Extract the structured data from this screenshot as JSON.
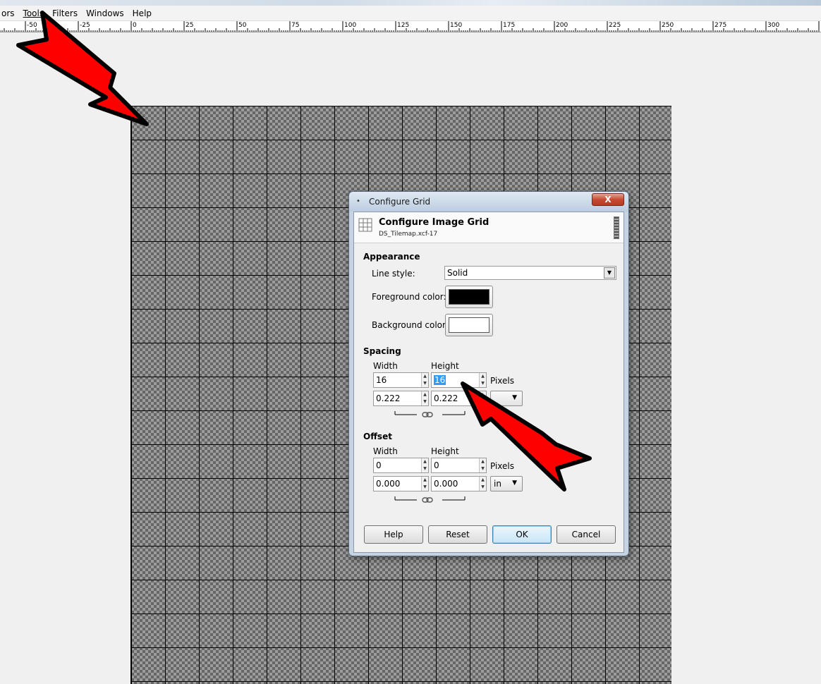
{
  "window": {
    "title_fragment": "ors"
  },
  "menubar": {
    "items": [
      {
        "label": "ors",
        "key": "colors"
      },
      {
        "label": "Tools",
        "key": "tools"
      },
      {
        "label": "Filters",
        "key": "filters"
      },
      {
        "label": "Windows",
        "key": "windows"
      },
      {
        "label": "Help",
        "key": "help"
      }
    ]
  },
  "ruler": {
    "labels": [
      "-50",
      "-25",
      "0",
      "25",
      "50",
      "75",
      "100",
      "125",
      "150",
      "175",
      "200",
      "225",
      "250",
      "275",
      "300"
    ]
  },
  "dialog": {
    "window_title": "Configure Grid",
    "close_label": "X",
    "heading": "Configure Image Grid",
    "subtitle": "DS_Tilemap.xcf-17",
    "appearance": {
      "section": "Appearance",
      "line_style_label": "Line style:",
      "line_style_value": "Solid",
      "foreground_label": "Foreground color:",
      "foreground_color": "#000000",
      "background_label": "Background color:",
      "background_color": "#ffffff"
    },
    "spacing": {
      "section": "Spacing",
      "width_label": "Width",
      "height_label": "Height",
      "width_px": "16",
      "height_px": "16",
      "pixels_label": "Pixels",
      "width_in": "0.222",
      "height_in": "0.222",
      "unit": ""
    },
    "offset": {
      "section": "Offset",
      "width_label": "Width",
      "height_label": "Height",
      "width_px": "0",
      "height_px": "0",
      "pixels_label": "Pixels",
      "width_in": "0.000",
      "height_in": "0.000",
      "unit": "in"
    },
    "buttons": {
      "help": "Help",
      "reset": "Reset",
      "ok": "OK",
      "cancel": "Cancel"
    }
  },
  "colors": {
    "arrow_fill": "#ff0000",
    "arrow_outline": "#000000",
    "grid_line": "#000000"
  }
}
